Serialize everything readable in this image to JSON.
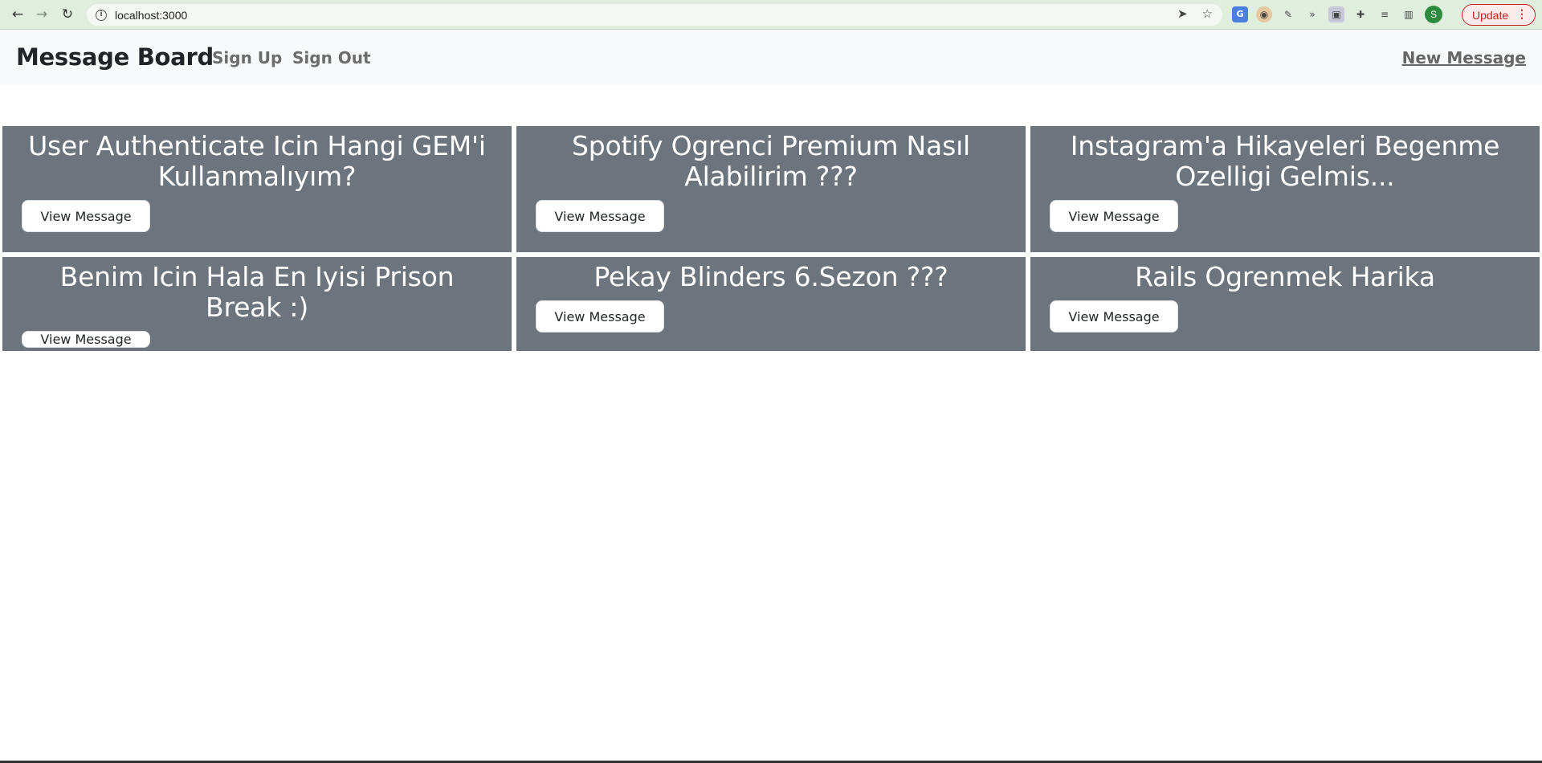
{
  "browser": {
    "url": "localhost:3000",
    "update_label": "Update",
    "profile_initial": "S"
  },
  "navbar": {
    "brand": "Message Board",
    "links": [
      "Sign Up",
      "Sign Out"
    ],
    "new_message": "New Message"
  },
  "messages": [
    {
      "title": "User Authenticate Icin Hangi GEM'i Kullanmalıyım?",
      "button": "View Message"
    },
    {
      "title": "Spotify Ogrenci Premium Nasıl Alabilirim ???",
      "button": "View Message"
    },
    {
      "title": "Instagram'a Hikayeleri Begenme Ozelligi Gelmis...",
      "button": "View Message"
    },
    {
      "title": "Benim Icin Hala En Iyisi Prison Break :)",
      "button": "View Message"
    },
    {
      "title": "Pekay Blinders 6.Sezon ???",
      "button": "View Message"
    },
    {
      "title": "Rails Ogrenmek Harika",
      "button": "View Message"
    }
  ]
}
